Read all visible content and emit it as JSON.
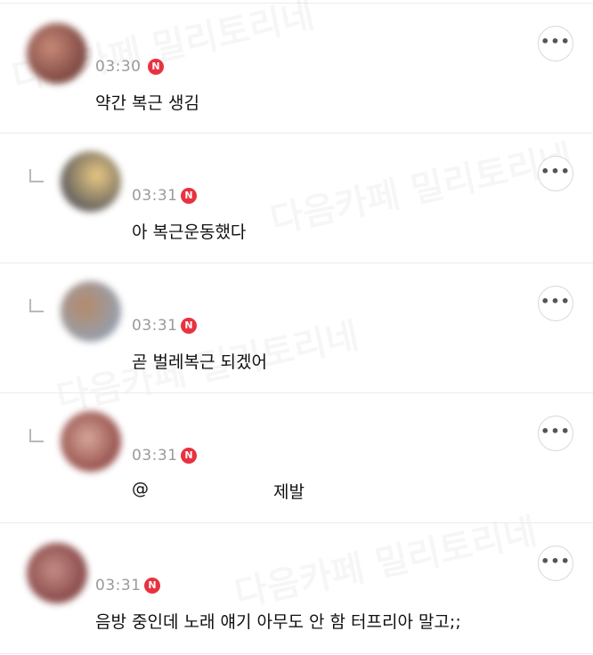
{
  "comments": [
    {
      "time": "03:30",
      "badge": "N",
      "text": "약간 복근 생김",
      "reply": false,
      "avatar_colors": [
        "#c98a78",
        "#5a2a2a"
      ]
    },
    {
      "time": "03:31",
      "badge": "N",
      "text": "아 복근운동했다",
      "reply": true,
      "avatar_colors": [
        "#e9c982",
        "#2d3550"
      ]
    },
    {
      "time": "03:31",
      "badge": "N",
      "text": "곧 벌레복근 되겠어",
      "reply": true,
      "avatar_colors": [
        "#b58a6a",
        "#8aa7c7"
      ]
    },
    {
      "time": "03:31",
      "badge": "N",
      "text_mention": "@",
      "text_body": "제발",
      "reply": true,
      "avatar_colors": [
        "#d7a79a",
        "#7a2b2b"
      ]
    },
    {
      "time": "03:31",
      "badge": "N",
      "text": "음방 중인데 노래 얘기 아무도 안 함 터프리아 말고;;",
      "reply": false,
      "avatar_colors": [
        "#c58d86",
        "#6d2a2e"
      ]
    }
  ],
  "more_label": "•••",
  "watermark": "다음카페 밀리토리네",
  "colors": {
    "badge": "#e8323f",
    "time": "#9a9a9a",
    "divider": "#ececec"
  }
}
